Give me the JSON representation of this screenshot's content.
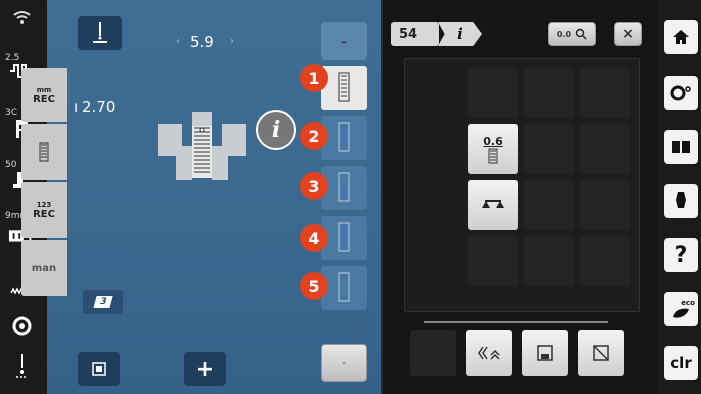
{
  "leftbar": {
    "tension_value": "2.5",
    "presser_value": "3C",
    "pressure_value": "50",
    "needle_value": "9mm"
  },
  "main": {
    "stitch_width": "5.9",
    "stitch_length": "2.70",
    "buttonhole_steps": [
      "1",
      "2",
      "3",
      "4",
      "5"
    ],
    "foot_label": "3",
    "add_label": "+",
    "scroll_up_label": "-",
    "scroll_down_label": "-"
  },
  "right": {
    "pattern_number": "54",
    "info_label": "i",
    "zoom_label": "0.0",
    "close_label": "×",
    "tabs": [
      {
        "top": "mm",
        "bottom": "REC"
      },
      {
        "top": "",
        "bottom": ""
      },
      {
        "top": "123",
        "bottom": "REC"
      },
      {
        "top": "",
        "bottom": "man"
      }
    ],
    "length_value": "0.6"
  },
  "farright": {
    "clr_label": "clr",
    "help_label": "?",
    "eco_label": "eco"
  }
}
